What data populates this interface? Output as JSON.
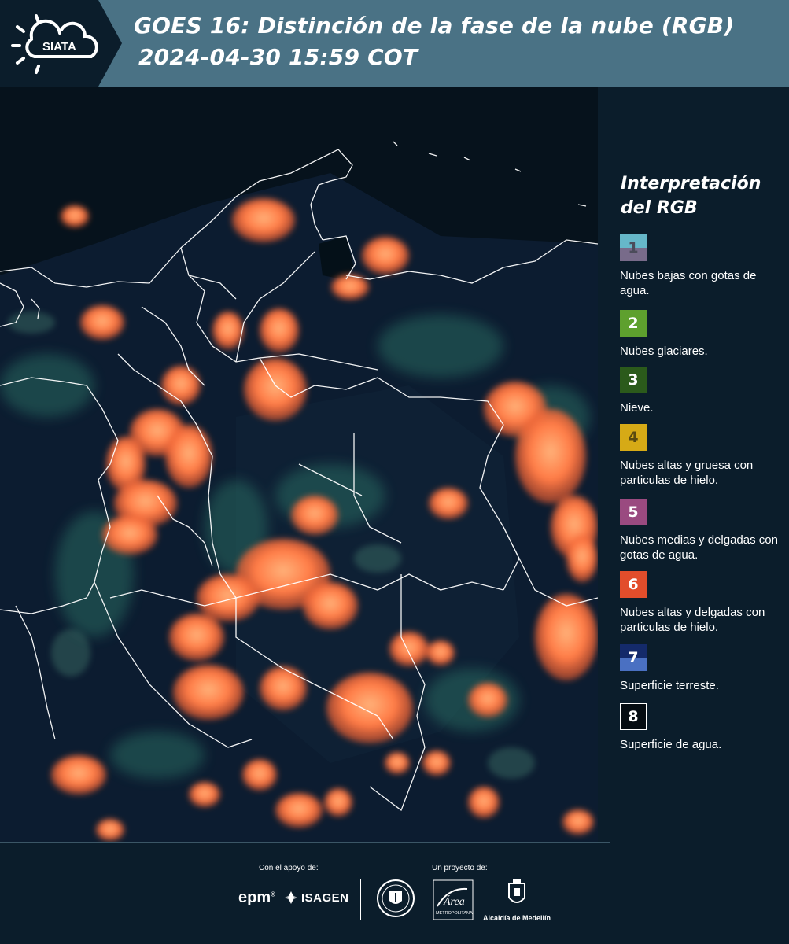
{
  "header": {
    "logo_text": "SIATA",
    "title_line1": "GOES 16: Distinción de la fase de la nube (RGB)",
    "title_line2": "2024-04-30 15:59 COT"
  },
  "legend": {
    "title": "Interpretación del RGB",
    "items": [
      {
        "number": "1",
        "label": "Nubes bajas con gotas de agua.",
        "color_top": "#66b7c9",
        "color_bottom": "#786b8a"
      },
      {
        "number": "2",
        "label": "Nubes glaciares.",
        "color_top": "#5ea02e",
        "color_bottom": "#5ea02e"
      },
      {
        "number": "3",
        "label": "Nieve.",
        "color_top": "#2b5a1b",
        "color_bottom": "#2b5a1b"
      },
      {
        "number": "4",
        "label": "Nubes altas y gruesa con particulas de hielo.",
        "color_top": "#d6aa16",
        "color_bottom": "#d6aa16"
      },
      {
        "number": "5",
        "label": "Nubes medias y delgadas con gotas de agua.",
        "color_top": "#9a4a80",
        "color_bottom": "#9a4a80"
      },
      {
        "number": "6",
        "label": "Nubes altas y delgadas con particulas de hielo.",
        "color_top": "#e24d2b",
        "color_bottom": "#e24d2b"
      },
      {
        "number": "7",
        "label": "Superficie terreste.",
        "color_top": "#142a6a",
        "color_bottom": "#4a70c2"
      },
      {
        "number": "8",
        "label": "Superficie de agua.",
        "color_top": "#050c12",
        "color_bottom": "#050c12"
      }
    ]
  },
  "footer": {
    "support_label": "Con el apoyo de:",
    "project_label": "Un proyecto de:",
    "epm": "epm",
    "isagen": "ISAGEN",
    "area_text": "Área",
    "area_sub": "METROPOLITANA",
    "alcaldia": "Alcaldía de Medellín"
  },
  "colors": {
    "header_bg": "#4a7285",
    "panel_bg": "#0b1d2b",
    "cloud_orange": "#ff7a45",
    "border_white": "#ffffff"
  }
}
